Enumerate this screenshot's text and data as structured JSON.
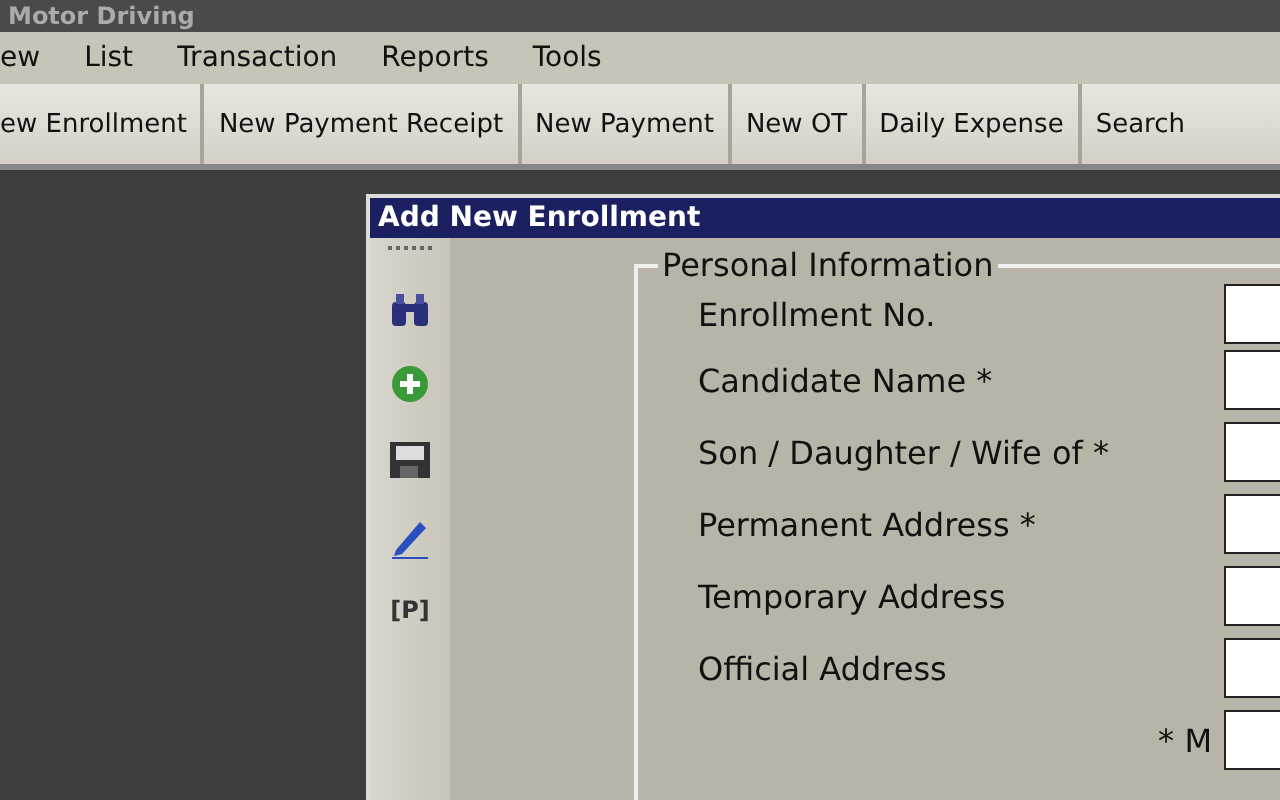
{
  "window": {
    "title": "Motor Driving"
  },
  "menu": [
    "ew",
    "List",
    "Transaction",
    "Reports",
    "Tools"
  ],
  "toolbar": [
    "ew Enrollment",
    "New Payment Receipt",
    "New Payment",
    "New OT",
    "Daily Expense",
    "Search"
  ],
  "dialog": {
    "title": "Add New Enrollment",
    "side_tools": [
      {
        "kind": "binoculars"
      },
      {
        "kind": "add"
      },
      {
        "kind": "save"
      },
      {
        "kind": "pen"
      },
      {
        "kind": "text",
        "label": "[P]"
      }
    ],
    "group": {
      "title": "Personal Information",
      "fields": [
        {
          "label": "Enrollment No.",
          "required": false
        },
        {
          "label": "Candidate Name",
          "required": true
        },
        {
          "label": "Son / Daughter / Wife of",
          "required": true
        },
        {
          "label": "Permanent Address",
          "required": true
        },
        {
          "label": "Temporary Address",
          "required": false
        },
        {
          "label": "Official Address",
          "required": false
        }
      ],
      "partial_row": {
        "mark": "*",
        "label_2": "M"
      }
    }
  }
}
